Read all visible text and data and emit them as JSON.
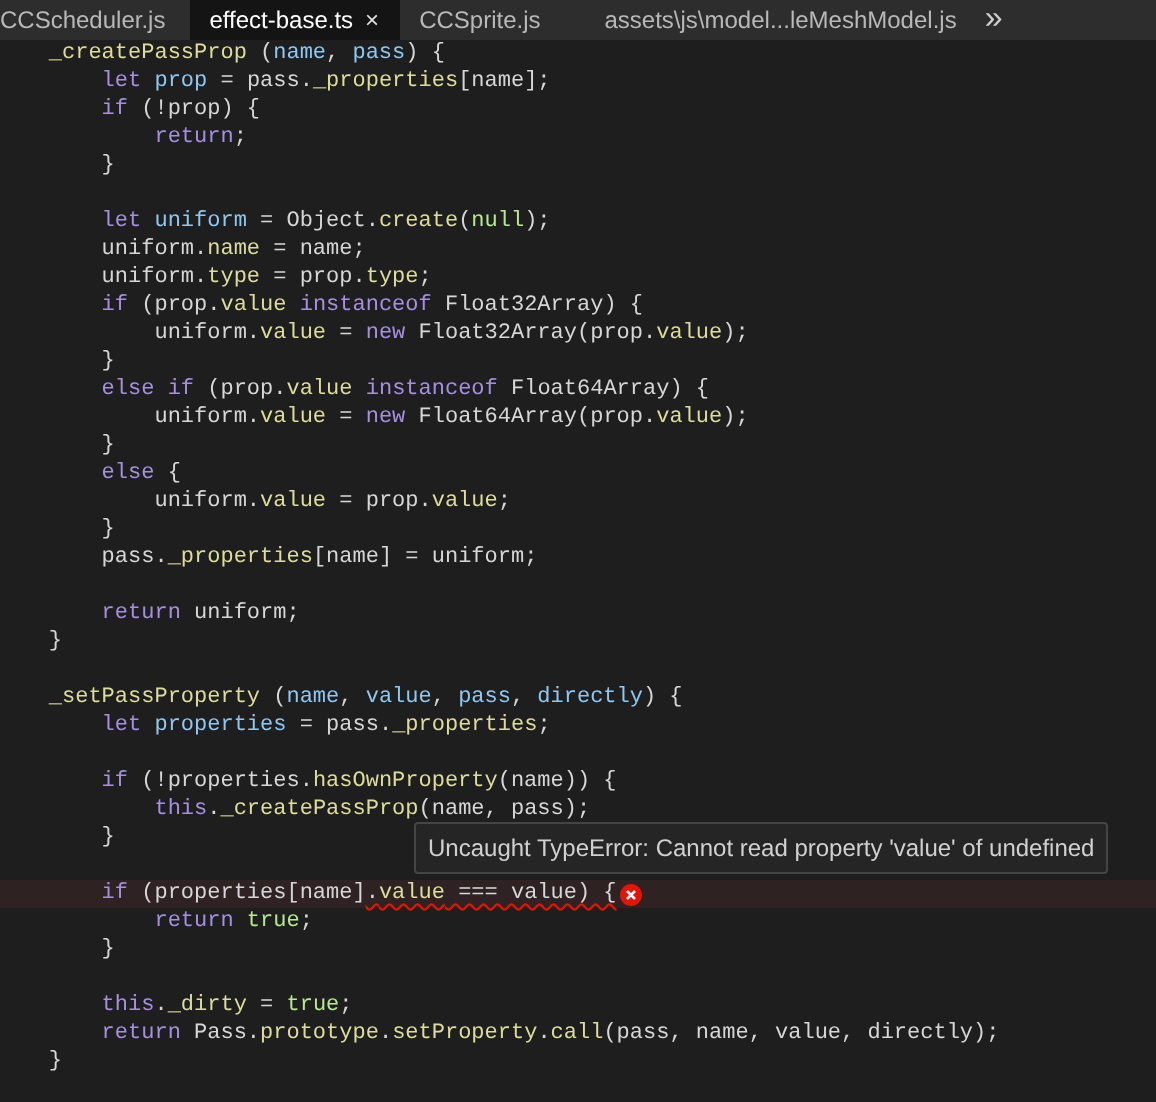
{
  "tabs": [
    {
      "label": "CCScheduler.js",
      "selected": false
    },
    {
      "label": "effect-base.ts",
      "selected": true,
      "close": "×"
    },
    {
      "label": "CCSprite.js",
      "selected": false
    },
    {
      "label": "assets\\js\\model...leMeshModel.js",
      "selected": false
    }
  ],
  "overflow": "»",
  "lines": [
    {
      "kind": "code",
      "tokens": [
        {
          "text": "    _createPassProp",
          "kind": "fn"
        },
        {
          "text": " (",
          "kind": "plain"
        },
        {
          "text": "name",
          "kind": "var"
        },
        {
          "text": ", ",
          "kind": "plain"
        },
        {
          "text": "pass",
          "kind": "var"
        },
        {
          "text": ") {",
          "kind": "plain"
        }
      ]
    },
    {
      "kind": "code",
      "tokens": [
        {
          "text": "        let",
          "kind": "kw"
        },
        {
          "text": " prop",
          "kind": "var"
        },
        {
          "text": " = pass.",
          "kind": "plain"
        },
        {
          "text": "_properties",
          "kind": "fn"
        },
        {
          "text": "[name];",
          "kind": "plain"
        }
      ]
    },
    {
      "kind": "code",
      "tokens": [
        {
          "text": "        if",
          "kind": "kw"
        },
        {
          "text": " (!prop) {",
          "kind": "plain"
        }
      ]
    },
    {
      "kind": "code",
      "tokens": [
        {
          "text": "            return",
          "kind": "kw"
        },
        {
          "text": ";",
          "kind": "plain"
        }
      ]
    },
    {
      "kind": "code",
      "tokens": [
        {
          "text": "        }",
          "kind": "plain"
        }
      ]
    },
    {
      "kind": "blank"
    },
    {
      "kind": "code",
      "tokens": [
        {
          "text": "        let",
          "kind": "kw"
        },
        {
          "text": " uniform",
          "kind": "var"
        },
        {
          "text": " = Object.",
          "kind": "plain"
        },
        {
          "text": "create",
          "kind": "fn"
        },
        {
          "text": "(",
          "kind": "plain"
        },
        {
          "text": "null",
          "kind": "lit"
        },
        {
          "text": ");",
          "kind": "plain"
        }
      ]
    },
    {
      "kind": "code",
      "tokens": [
        {
          "text": "        uniform.",
          "kind": "plain"
        },
        {
          "text": "name",
          "kind": "fn"
        },
        {
          "text": " = name;",
          "kind": "plain"
        }
      ]
    },
    {
      "kind": "code",
      "tokens": [
        {
          "text": "        uniform.",
          "kind": "plain"
        },
        {
          "text": "type",
          "kind": "fn"
        },
        {
          "text": " = prop.",
          "kind": "plain"
        },
        {
          "text": "type",
          "kind": "fn"
        },
        {
          "text": ";",
          "kind": "plain"
        }
      ]
    },
    {
      "kind": "code",
      "tokens": [
        {
          "text": "        if",
          "kind": "kw"
        },
        {
          "text": " (prop.",
          "kind": "plain"
        },
        {
          "text": "value",
          "kind": "fn"
        },
        {
          "text": " instanceof",
          "kind": "kw"
        },
        {
          "text": " Float32Array) {",
          "kind": "plain"
        }
      ]
    },
    {
      "kind": "code",
      "tokens": [
        {
          "text": "            uniform.",
          "kind": "plain"
        },
        {
          "text": "value",
          "kind": "fn"
        },
        {
          "text": " = ",
          "kind": "plain"
        },
        {
          "text": "new",
          "kind": "kw"
        },
        {
          "text": " Float32Array(prop.",
          "kind": "plain"
        },
        {
          "text": "value",
          "kind": "fn"
        },
        {
          "text": ");",
          "kind": "plain"
        }
      ]
    },
    {
      "kind": "code",
      "tokens": [
        {
          "text": "        }",
          "kind": "plain"
        }
      ]
    },
    {
      "kind": "code",
      "tokens": [
        {
          "text": "        else if",
          "kind": "kw"
        },
        {
          "text": " (prop.",
          "kind": "plain"
        },
        {
          "text": "value",
          "kind": "fn"
        },
        {
          "text": " instanceof",
          "kind": "kw"
        },
        {
          "text": " Float64Array) {",
          "kind": "plain"
        }
      ]
    },
    {
      "kind": "code",
      "tokens": [
        {
          "text": "            uniform.",
          "kind": "plain"
        },
        {
          "text": "value",
          "kind": "fn"
        },
        {
          "text": " = ",
          "kind": "plain"
        },
        {
          "text": "new",
          "kind": "kw"
        },
        {
          "text": " Float64Array(prop.",
          "kind": "plain"
        },
        {
          "text": "value",
          "kind": "fn"
        },
        {
          "text": ");",
          "kind": "plain"
        }
      ]
    },
    {
      "kind": "code",
      "tokens": [
        {
          "text": "        }",
          "kind": "plain"
        }
      ]
    },
    {
      "kind": "code",
      "tokens": [
        {
          "text": "        else",
          "kind": "kw"
        },
        {
          "text": " {",
          "kind": "plain"
        }
      ]
    },
    {
      "kind": "code",
      "tokens": [
        {
          "text": "            uniform.",
          "kind": "plain"
        },
        {
          "text": "value",
          "kind": "fn"
        },
        {
          "text": " = prop.",
          "kind": "plain"
        },
        {
          "text": "value",
          "kind": "fn"
        },
        {
          "text": ";",
          "kind": "plain"
        }
      ]
    },
    {
      "kind": "code",
      "tokens": [
        {
          "text": "        }",
          "kind": "plain"
        }
      ]
    },
    {
      "kind": "code",
      "tokens": [
        {
          "text": "        pass.",
          "kind": "plain"
        },
        {
          "text": "_properties",
          "kind": "fn"
        },
        {
          "text": "[name] = uniform;",
          "kind": "plain"
        }
      ]
    },
    {
      "kind": "blank"
    },
    {
      "kind": "code",
      "tokens": [
        {
          "text": "        return",
          "kind": "kw"
        },
        {
          "text": " uniform;",
          "kind": "plain"
        }
      ]
    },
    {
      "kind": "code",
      "tokens": [
        {
          "text": "    }",
          "kind": "plain"
        }
      ]
    },
    {
      "kind": "blank"
    },
    {
      "kind": "code",
      "tokens": [
        {
          "text": "    _setPassProperty",
          "kind": "fn"
        },
        {
          "text": " (",
          "kind": "plain"
        },
        {
          "text": "name",
          "kind": "var"
        },
        {
          "text": ", ",
          "kind": "plain"
        },
        {
          "text": "value",
          "kind": "var"
        },
        {
          "text": ", ",
          "kind": "plain"
        },
        {
          "text": "pass",
          "kind": "var"
        },
        {
          "text": ", ",
          "kind": "plain"
        },
        {
          "text": "directly",
          "kind": "var"
        },
        {
          "text": ") {",
          "kind": "plain"
        }
      ]
    },
    {
      "kind": "code",
      "tokens": [
        {
          "text": "        let",
          "kind": "kw"
        },
        {
          "text": " properties",
          "kind": "var"
        },
        {
          "text": " = pass.",
          "kind": "plain"
        },
        {
          "text": "_properties",
          "kind": "fn"
        },
        {
          "text": ";",
          "kind": "plain"
        }
      ]
    },
    {
      "kind": "blank"
    },
    {
      "kind": "code",
      "tokens": [
        {
          "text": "        if",
          "kind": "kw"
        },
        {
          "text": " (!properties.",
          "kind": "plain"
        },
        {
          "text": "hasOwnProperty",
          "kind": "fn"
        },
        {
          "text": "(name)) {",
          "kind": "plain"
        }
      ]
    },
    {
      "kind": "code",
      "tokens": [
        {
          "text": "            this",
          "kind": "kw"
        },
        {
          "text": ".",
          "kind": "plain"
        },
        {
          "text": "_createPassProp",
          "kind": "fn"
        },
        {
          "text": "(name, pass);",
          "kind": "plain"
        }
      ]
    },
    {
      "kind": "code",
      "tokens": [
        {
          "text": "        }",
          "kind": "plain"
        }
      ]
    },
    {
      "kind": "blank"
    },
    {
      "kind": "code",
      "error": true,
      "tokens": [
        {
          "text": "        if",
          "kind": "kw",
          "error": false
        },
        {
          "text": " (properties[name]",
          "kind": "plain",
          "error": false
        },
        {
          "text": ".",
          "kind": "plain",
          "error": true
        },
        {
          "text": "value",
          "kind": "fn",
          "error": true
        },
        {
          "text": " === value) {",
          "kind": "plain",
          "error": true
        }
      ]
    },
    {
      "kind": "code",
      "tokens": [
        {
          "text": "            return",
          "kind": "kw"
        },
        {
          "text": " true",
          "kind": "lit"
        },
        {
          "text": ";",
          "kind": "plain"
        }
      ]
    },
    {
      "kind": "code",
      "tokens": [
        {
          "text": "        }",
          "kind": "plain"
        }
      ]
    },
    {
      "kind": "blank"
    },
    {
      "kind": "code",
      "tokens": [
        {
          "text": "        this",
          "kind": "kw"
        },
        {
          "text": ".",
          "kind": "plain"
        },
        {
          "text": "_dirty",
          "kind": "fn"
        },
        {
          "text": " = ",
          "kind": "plain"
        },
        {
          "text": "true",
          "kind": "lit"
        },
        {
          "text": ";",
          "kind": "plain"
        }
      ]
    },
    {
      "kind": "code",
      "tokens": [
        {
          "text": "        return",
          "kind": "kw"
        },
        {
          "text": " Pass.",
          "kind": "plain"
        },
        {
          "text": "prototype",
          "kind": "fn"
        },
        {
          "text": ".",
          "kind": "plain"
        },
        {
          "text": "setProperty",
          "kind": "fn"
        },
        {
          "text": ".",
          "kind": "plain"
        },
        {
          "text": "call",
          "kind": "fn"
        },
        {
          "text": "(pass, name, value, directly);",
          "kind": "plain"
        }
      ]
    },
    {
      "kind": "code",
      "tokens": [
        {
          "text": "    }",
          "kind": "plain"
        }
      ]
    }
  ],
  "tooltip": {
    "message": "Uncaught TypeError: Cannot read property 'value' of undefined"
  }
}
